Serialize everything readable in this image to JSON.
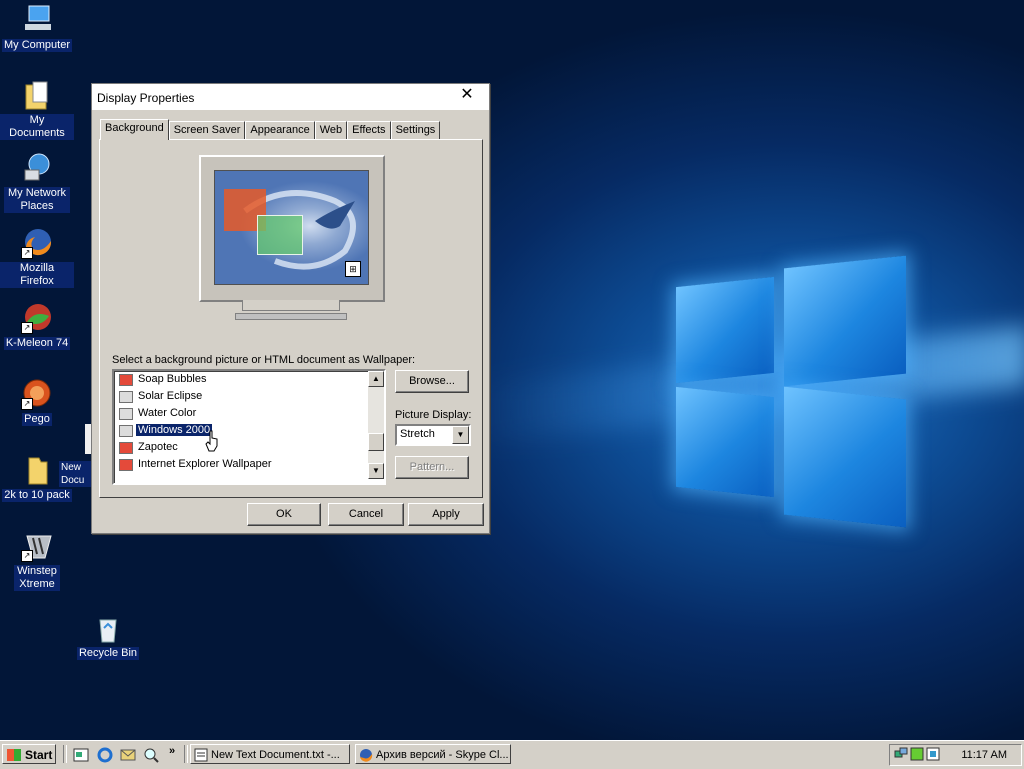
{
  "desktop": {
    "icons": [
      {
        "label": "My Computer"
      },
      {
        "label": "My Documents"
      },
      {
        "label": "My Network Places"
      },
      {
        "label": "Mozilla Firefox"
      },
      {
        "label": "K-Meleon 74"
      },
      {
        "label": "Pego"
      },
      {
        "label": "2k to 10 pack"
      },
      {
        "label": "Winstep Xtreme"
      },
      {
        "label": "Recycle Bin"
      },
      {
        "label": "New Docu"
      }
    ]
  },
  "dialog": {
    "title": "Display Properties",
    "close_glyph": "✕",
    "tabs": [
      "Background",
      "Screen Saver",
      "Appearance",
      "Web",
      "Effects",
      "Settings"
    ],
    "active_tab": "Background",
    "wallpaper_label": "Select a background picture or HTML document as Wallpaper:",
    "wallpapers": [
      {
        "name": "Soap Bubbles",
        "icon": "red"
      },
      {
        "name": "Solar Eclipse",
        "icon": "gray"
      },
      {
        "name": "Water Color",
        "icon": "gray"
      },
      {
        "name": "Windows 2000",
        "icon": "gray",
        "selected": true
      },
      {
        "name": "Zapotec",
        "icon": "red"
      },
      {
        "name": "Internet Explorer Wallpaper",
        "icon": "red"
      }
    ],
    "browse_label": "Browse...",
    "picture_display_label": "Picture Display:",
    "picture_display_value": "Stretch",
    "pattern_label": "Pattern...",
    "ok_label": "OK",
    "cancel_label": "Cancel",
    "apply_label": "Apply"
  },
  "taskbar": {
    "start_label": "Start",
    "more_glyph": "»",
    "tasks": [
      {
        "label": "New Text Document.txt -..."
      },
      {
        "label": "Архив версий - Skype Cl..."
      }
    ],
    "clock": "11:17 AM"
  },
  "colors": {
    "selection": "#0a246a",
    "face": "#d4d0c8",
    "wallpaper_blue": "#0d4b93"
  }
}
